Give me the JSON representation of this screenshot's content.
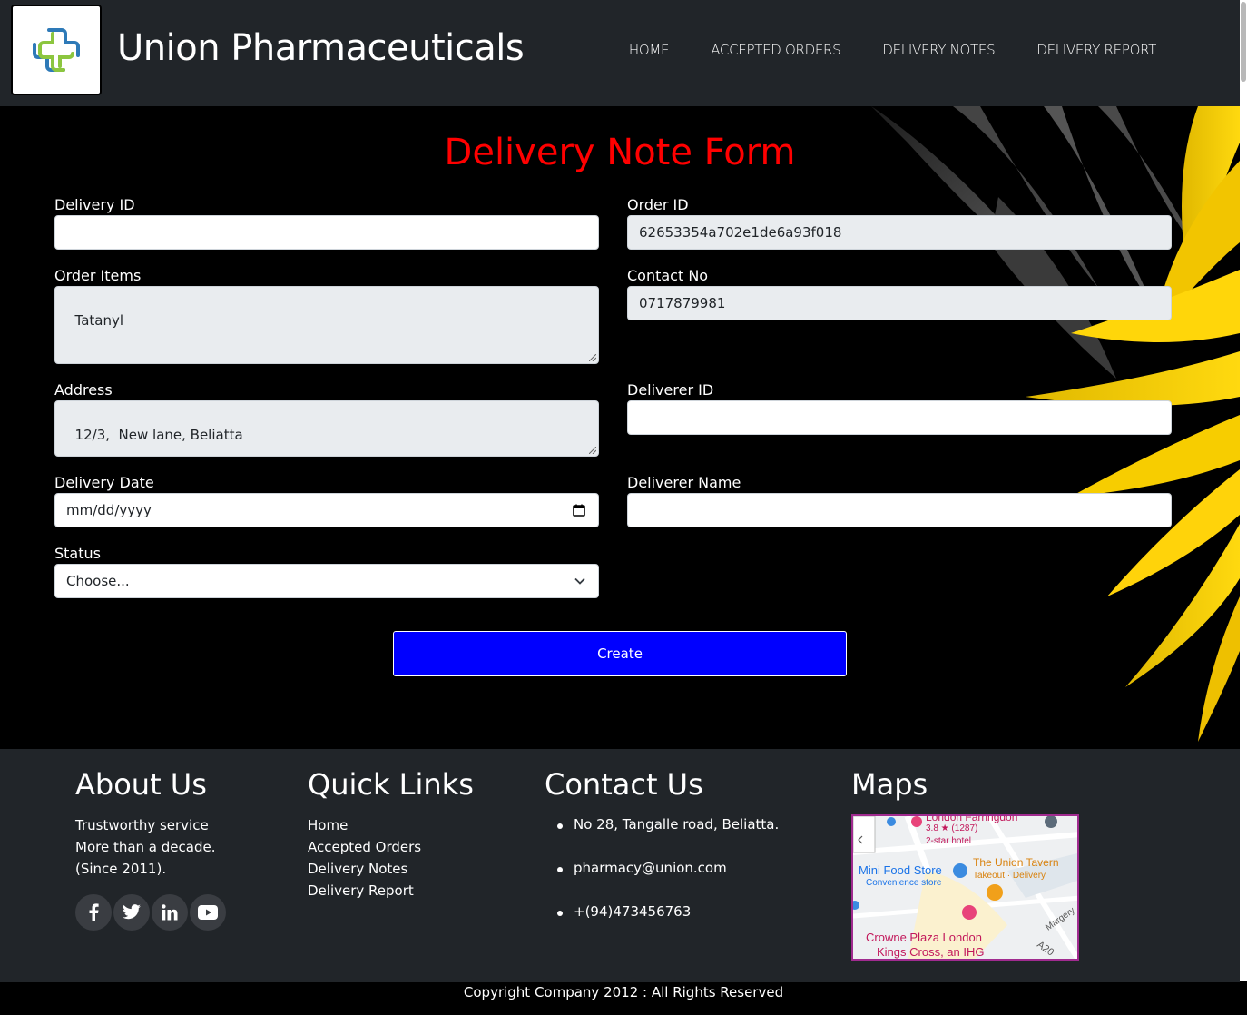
{
  "header": {
    "brand": "Union Pharmaceuticals",
    "logo_icon": "medical-cross-logo",
    "nav": [
      "HOME",
      "ACCEPTED ORDERS",
      "DELIVERY NOTES",
      "DELIVERY REPORT"
    ]
  },
  "form": {
    "title": "Delivery Note Form",
    "fields": {
      "delivery_id": {
        "label": "Delivery ID",
        "value": ""
      },
      "order_id": {
        "label": "Order ID",
        "value": "62653354a702e1de6a93f018"
      },
      "order_items": {
        "label": "Order Items",
        "value": "Tatanyl"
      },
      "contact_no": {
        "label": "Contact No",
        "value": "0717879981"
      },
      "address": {
        "label": "Address",
        "value": "12/3,  New lane, Beliatta"
      },
      "deliverer_id": {
        "label": "Deliverer ID",
        "value": ""
      },
      "delivery_date": {
        "label": "Delivery Date",
        "value": "mm/dd/yyyy"
      },
      "deliverer_name": {
        "label": "Deliverer Name",
        "value": ""
      },
      "status": {
        "label": "Status",
        "value": "Choose..."
      }
    },
    "submit_label": "Create"
  },
  "footer": {
    "about": {
      "title": "About Us",
      "lines": [
        "Trustworthy service",
        "More than a decade.",
        "(Since 2011)."
      ],
      "social_icons": [
        "facebook-icon",
        "twitter-icon",
        "linkedin-icon",
        "youtube-icon"
      ]
    },
    "quick_links": {
      "title": "Quick Links",
      "links": [
        "Home",
        "Accepted Orders",
        "Delivery Notes",
        "Delivery Report"
      ]
    },
    "contact": {
      "title": "Contact Us",
      "items": [
        "No 28, Tangalle road, Beliatta.",
        "pharmacy@union.com",
        "+(94)473456763"
      ]
    },
    "maps": {
      "title": "Maps",
      "labels": [
        "London Farringdon",
        "3.8 ★ (1287)",
        "2-star hotel",
        "Mini Food Store",
        "Convenience store",
        "The Union Tavern",
        "Takeout · Delivery",
        "Crowne Plaza London",
        "Kings Cross, an IHG",
        "Margery",
        "A20"
      ]
    },
    "copyright": "Copyright Company 2012 : All Rights Reserved"
  },
  "colors": {
    "navbar": "#212529",
    "title_red": "#ff0000",
    "button_blue": "#0000ff",
    "readonly_bg": "#e9ecef"
  }
}
